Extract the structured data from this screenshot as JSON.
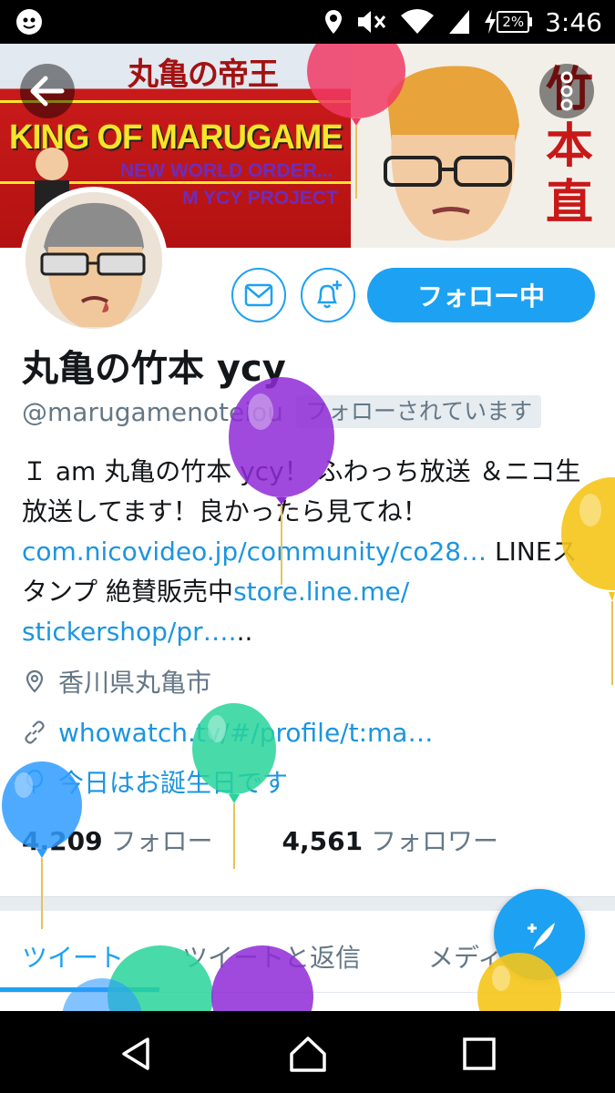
{
  "status_bar": {
    "time": "3:46",
    "battery": "2%"
  },
  "banner": {
    "title_jp": "丸亀の帝王",
    "title_en": "KING OF MARUGAME",
    "tagline1": "NEW WORLD ORDER...",
    "tagline2": "M YCY PROJECT",
    "vertical_name": "竹本直"
  },
  "profile": {
    "display_name": "丸亀の竹本 ycy",
    "handle": "@marugamenoteiou",
    "follows_you": "フォローされています",
    "follow_button": "フォロー中",
    "bio_text1": "Ｉ am 丸亀の竹本 ycy！ ふわっち放送 ＆ニコ生放送してます！良かったら見てね！",
    "bio_link1": "com.nicovideo.jp/community/co28…",
    "bio_text2": " LINEスタンプ 絶賛販売中",
    "bio_link2": "store.line.me/",
    "bio_link3": "stickershop/pr….",
    "bio_text3": "..",
    "location": "香川県丸亀市",
    "website": "whowatch.tv/#/profile/t:ma…",
    "birthday": "今日はお誕生日です",
    "following_count": "4,209",
    "following_label": "フォロー",
    "followers_count": "4,561",
    "followers_label": "フォロワー"
  },
  "tabs": [
    {
      "label": "ツイート"
    },
    {
      "label": "ツイートと返信"
    },
    {
      "label": "メディア"
    }
  ],
  "colors": {
    "accent": "#1da1f2",
    "link": "#1b95e0",
    "secondary_text": "#657786"
  }
}
